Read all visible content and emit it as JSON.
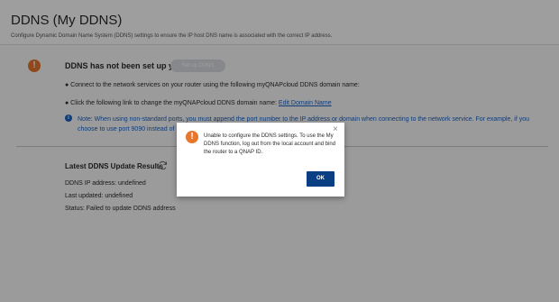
{
  "header": {
    "title": "DDNS (My DDNS)",
    "subtitle": "Configure Dynamic Domain Name System (DDNS) settings to ensure the IP host DNS name is associated with the correct IP address."
  },
  "status": {
    "icon": "warning-icon",
    "title": "DDNS has not been set up yet.",
    "setup_button": "Set up DDNS"
  },
  "instructions": {
    "bullet1": "● Connect to the network services on your router using the following myQNAPcloud DDNS domain name:",
    "bullet2_text": "● Click the following link to change the myQNAPcloud DDNS domain name:",
    "bullet2_link": "Edit Domain Name",
    "note": "Note: When using non-standard ports, you must append the port number to the IP address or domain when connecting to the network service. For example, if you choose to use port 9090 instead of ..."
  },
  "results": {
    "title": "Latest DDNS Update Results",
    "ip": "DDNS IP address: undefined",
    "updated": "Last updated: undefined",
    "status": "Status: Failed to update DDNS address"
  },
  "dialog": {
    "icon": "warning-icon",
    "message": "Unable to configure the DDNS settings. To use the My DDNS function, log out from the local account and bind the router to a QNAP ID.",
    "ok_label": "OK",
    "close_glyph": "×"
  },
  "colors": {
    "warning": "#e8772e",
    "link": "#1a62c5",
    "primary_button": "#0b3f84"
  }
}
